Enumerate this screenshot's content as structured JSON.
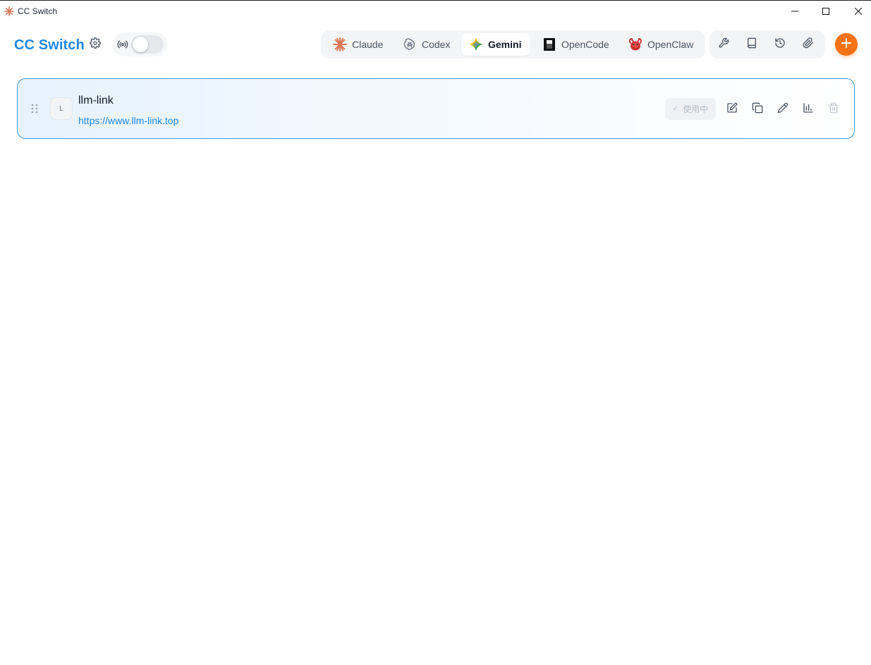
{
  "window": {
    "title": "CC Switch",
    "controls": [
      "minimize-icon",
      "maximize-icon",
      "close-icon"
    ]
  },
  "header": {
    "brand": "CC Switch",
    "proxy_toggle": {
      "icon": "broadcast-icon",
      "enabled": false
    }
  },
  "app_tabs": [
    {
      "label": "Claude",
      "icon": "claude-icon",
      "active": false
    },
    {
      "label": "Codex",
      "icon": "openai-icon",
      "active": false
    },
    {
      "label": "Gemini",
      "icon": "gemini-icon",
      "active": true
    },
    {
      "label": "OpenCode",
      "icon": "opencode-icon",
      "active": false
    },
    {
      "label": "OpenClaw",
      "icon": "openclaw-icon",
      "active": false
    }
  ],
  "toolbar": [
    "wrench-icon",
    "book-icon",
    "history-icon",
    "paperclip-icon"
  ],
  "provider": {
    "avatar_letter": "L",
    "name": "llm-link",
    "url": "https://www.llm-link.top",
    "status_label": "使用中",
    "actions": [
      "edit-icon",
      "copy-icon",
      "pen-icon",
      "chart-icon",
      "trash-icon"
    ]
  },
  "colors": {
    "brand": "#1e88e5",
    "accent": "#f97316",
    "card_border": "#3b9be8"
  }
}
